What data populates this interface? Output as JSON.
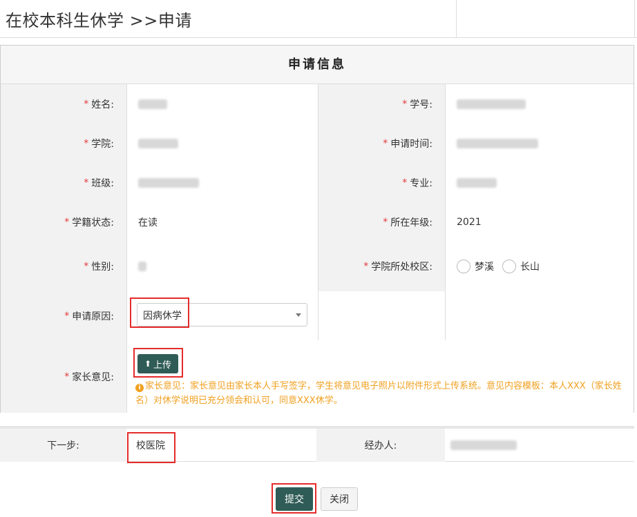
{
  "page": {
    "title": "在校本科生休学 >>申请"
  },
  "section": {
    "title": "申请信息"
  },
  "form": {
    "name": {
      "label": "姓名:",
      "value": ""
    },
    "student_id": {
      "label": "学号:",
      "value": ""
    },
    "college": {
      "label": "学院:",
      "value": ""
    },
    "apply_time": {
      "label": "申请时间:",
      "value": ""
    },
    "class": {
      "label": "班级:",
      "value": ""
    },
    "major": {
      "label": "专业:",
      "value": ""
    },
    "status": {
      "label": "学籍状态:",
      "value": "在读"
    },
    "grade": {
      "label": "所在年级:",
      "value": "2021"
    },
    "gender": {
      "label": "性别:",
      "value": ""
    },
    "campus": {
      "label": "学院所处校区:",
      "options": [
        "梦溪",
        "长山"
      ]
    },
    "reason": {
      "label": "申请原因:",
      "selected": "因病休学"
    },
    "parent_opinion": {
      "label": "家长意见:",
      "upload_label": "上传",
      "note": "家长意见：家长意见由家长本人手写签字，学生将意见电子照片以附件形式上传系统。意见内容模板：本人XXX（家长姓名）对休学说明已充分领会和认可，同意XXX休学。"
    }
  },
  "next_step": {
    "label": "下一步:",
    "value": "校医院",
    "handler_label": "经办人:",
    "handler_value": ""
  },
  "actions": {
    "submit": "提交",
    "close": "关闭"
  },
  "colors": {
    "primary": "#2f5c56",
    "required": "#e4393c",
    "warning": "#f0a020",
    "highlight": "#e52a2a"
  }
}
